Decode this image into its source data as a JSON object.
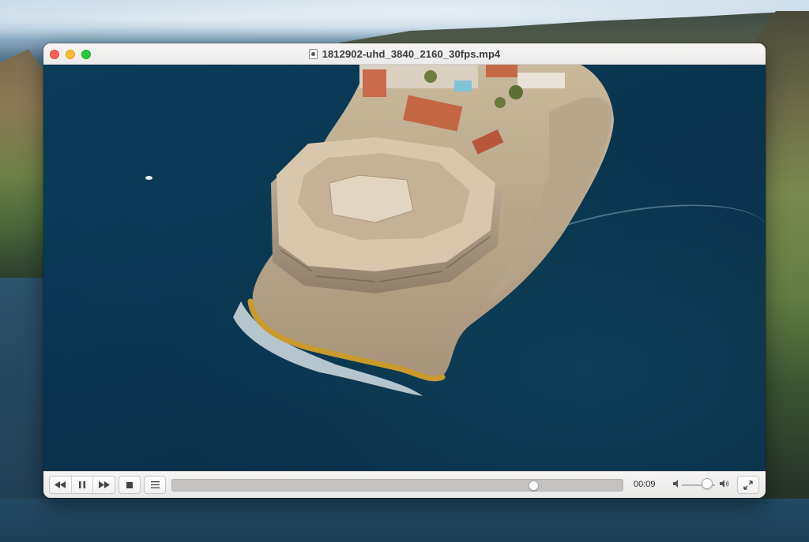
{
  "window": {
    "title": "1812902-uhd_3840_2160_30fps.mp4"
  },
  "player": {
    "elapsed": "00:09",
    "progress_fraction": 0.81,
    "volume_fraction": 0.75
  },
  "colors": {
    "close": "#fe5f57",
    "minimize": "#febc2e",
    "maximize": "#28c840"
  },
  "icons": {
    "rewind": "rewind-icon",
    "pause": "pause-icon",
    "fast_forward": "fast-forward-icon",
    "stop": "stop-icon",
    "playlist": "playlist-icon",
    "volume_low": "volume-low-icon",
    "volume_high": "volume-high-icon",
    "fullscreen": "fullscreen-icon"
  }
}
